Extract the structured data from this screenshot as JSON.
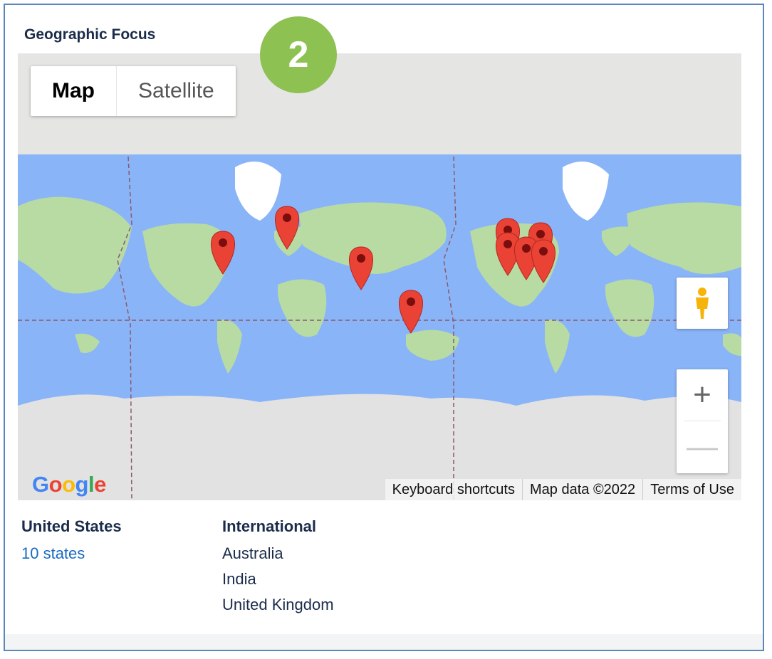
{
  "section": {
    "title": "Geographic Focus",
    "step_badge": "2"
  },
  "map": {
    "type_options": [
      "Map",
      "Satellite"
    ],
    "selected_type": "Map",
    "controls": {
      "zoom_in": "+",
      "zoom_out": "—"
    },
    "logo": "Google",
    "attribution": [
      "Keyboard shortcuts",
      "Map data ©2022",
      "Terms of Use"
    ],
    "colors": {
      "water": "#8ab4f8",
      "land": "#b7dba3",
      "ice": "#e4e4e4",
      "marker": "#ea4335"
    }
  },
  "summary": {
    "us": {
      "heading": "United States",
      "value": "10 states"
    },
    "international": {
      "heading": "International",
      "items": [
        "Australia",
        "India",
        "United Kingdom"
      ]
    }
  }
}
